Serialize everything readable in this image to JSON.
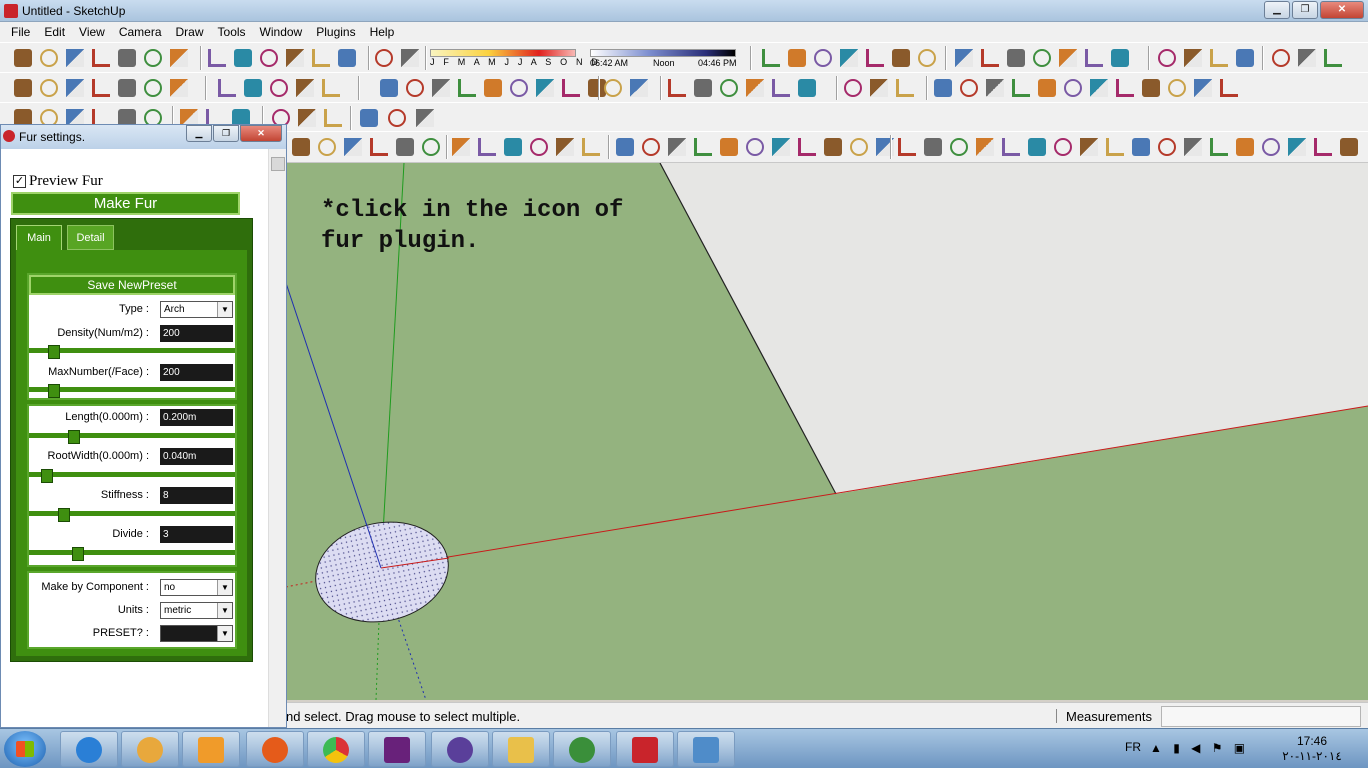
{
  "window": {
    "title": "Untitled - SketchUp",
    "controls": {
      "minimize": "▁",
      "maximize": "❐",
      "close": "✕"
    }
  },
  "menu": [
    "File",
    "Edit",
    "View",
    "Camera",
    "Draw",
    "Tools",
    "Window",
    "Plugins",
    "Help"
  ],
  "shadow": {
    "months": "J F M A M J J A S O N D",
    "time_start": "06:42 AM",
    "time_mid": "Noon",
    "time_end": "04:46 PM"
  },
  "viewport": {
    "instruction_line1": "*click in the icon of",
    "instruction_line2": "fur plugin.",
    "ground_color": "#94b37f",
    "plane_color": "#e6e6e4"
  },
  "status": {
    "text": "nd select. Drag mouse to select multiple.",
    "measurements_label": "Measurements",
    "measurements_value": ""
  },
  "fur": {
    "title": "Fur settings.",
    "preview_label": "Preview Fur",
    "preview_checked": true,
    "make_button": "Make Fur",
    "tabs": {
      "main": "Main",
      "detail": "Detail"
    },
    "save_preset": "Save NewPreset",
    "type_label": "Type :",
    "type_value": "Arch",
    "density_label": "Density(Num/m2) :",
    "density_value": "200",
    "density_level": 0.1,
    "maxnumber_label": "MaxNumber(/Face) :",
    "maxnumber_value": "200",
    "maxnumber_level": 0.1,
    "length_label": "Length(0.000m) :",
    "length_value": "0.200m",
    "length_level": 0.2,
    "rootwidth_label": "RootWidth(0.000m) :",
    "rootwidth_value": "0.040m",
    "rootwidth_level": 0.06,
    "stiffness_label": "Stiffness :",
    "stiffness_value": "8",
    "stiffness_level": 0.15,
    "divide_label": "Divide :",
    "divide_value": "3",
    "divide_level": 0.22,
    "component_label": "Make by Component :",
    "component_value": "no",
    "units_label": "Units :",
    "units_value": "metric",
    "preset_label": "PRESET? :",
    "preset_value": ""
  },
  "taskbar": {
    "language": "FR",
    "time": "17:46",
    "date": "٢٠١٤-١١-٢٠"
  }
}
